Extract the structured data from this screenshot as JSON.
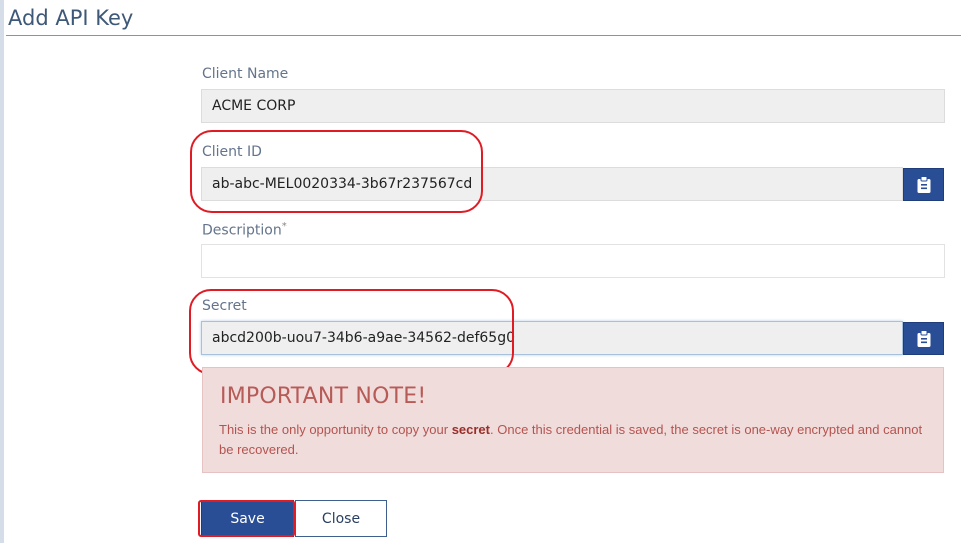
{
  "dialog": {
    "title": "Add API Key"
  },
  "fields": {
    "client_name": {
      "label": "Client Name",
      "value": "ACME CORP"
    },
    "client_id": {
      "label": "Client ID",
      "value": "ab-abc-MEL0020334-3b67r237567cd",
      "copy_icon": "clipboard-icon"
    },
    "description": {
      "label": "Description",
      "required_marker": "*",
      "value": ""
    },
    "secret": {
      "label": "Secret",
      "value": "abcd200b-uou7-34b6-a9ae-34562-def65g0",
      "copy_icon": "clipboard-icon"
    }
  },
  "note": {
    "heading": "IMPORTANT NOTE!",
    "text_before": "This is the only opportunity to copy your ",
    "text_bold": "secret",
    "text_after": ". Once this credential is saved, the secret is one-way encrypted and cannot be recovered."
  },
  "buttons": {
    "save_label": "Save",
    "close_label": "Close"
  },
  "colors": {
    "title": "#3e5878",
    "primary_button": "#2a4e96",
    "note_background": "#f1dcdc",
    "note_text": "#b4544f",
    "annotation_red": "#e01b24"
  }
}
